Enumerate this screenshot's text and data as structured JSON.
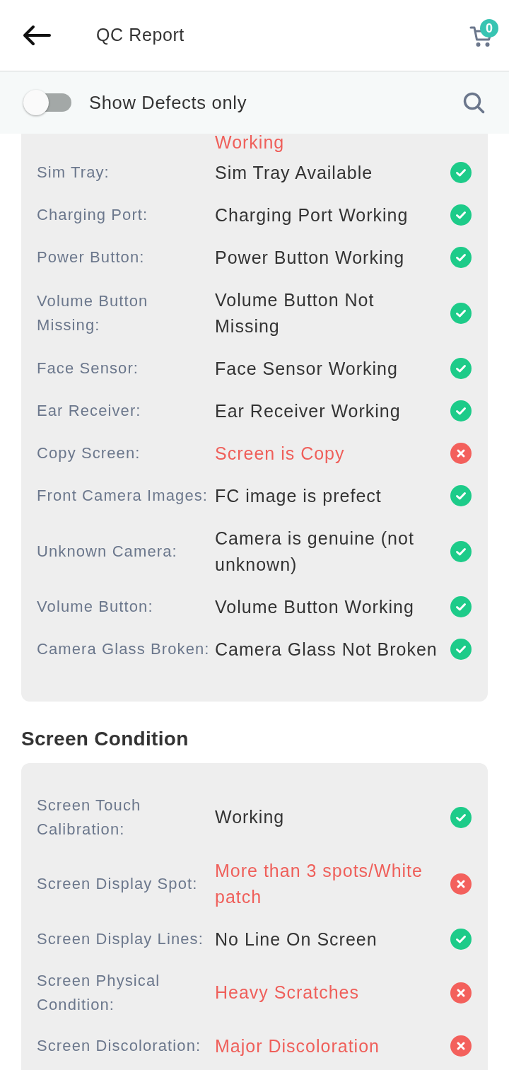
{
  "header": {
    "title": "QC Report",
    "cart_count": "0"
  },
  "filter_bar": {
    "toggle": {
      "label": "Show Defects only",
      "on": false
    }
  },
  "sections": [
    {
      "scrolled_value": {
        "text": "Working",
        "passed": false
      },
      "rows": [
        {
          "label": "Sim Tray:",
          "value": "Sim Tray Available",
          "passed": true
        },
        {
          "label": "Charging Port:",
          "value": "Charging Port Working",
          "passed": true
        },
        {
          "label": "Power Button:",
          "value": "Power Button Working",
          "passed": true
        },
        {
          "label": "Volume Button Missing:",
          "value": "Volume Button Not Missing",
          "passed": true
        },
        {
          "label": "Face Sensor:",
          "value": "Face Sensor Working",
          "passed": true
        },
        {
          "label": "Ear Receiver:",
          "value": "Ear Receiver Working",
          "passed": true
        },
        {
          "label": "Copy Screen:",
          "value": "Screen is Copy",
          "passed": false
        },
        {
          "label": "Front Camera Images:",
          "value": "FC image is prefect",
          "passed": true
        },
        {
          "label": "Unknown Camera:",
          "value": "Camera is genuine (not unknown)",
          "passed": true
        },
        {
          "label": "Volume Button:",
          "value": "Volume Button Working",
          "passed": true
        },
        {
          "label": "Camera Glass Broken:",
          "value": "Camera Glass Not Broken",
          "passed": true
        }
      ]
    },
    {
      "title": "Screen Condition",
      "rows": [
        {
          "label": "Screen Touch Calibration:",
          "value": "Working",
          "passed": true
        },
        {
          "label": "Screen Display Spot:",
          "value": "More than 3 spots/White patch",
          "passed": false
        },
        {
          "label": "Screen Display Lines:",
          "value": "No Line On Screen",
          "passed": true
        },
        {
          "label": "Screen Physical Condition:",
          "value": "Heavy Scratches",
          "passed": false
        },
        {
          "label": "Screen Discoloration:",
          "value": "Major Discoloration",
          "passed": false
        }
      ]
    }
  ]
}
